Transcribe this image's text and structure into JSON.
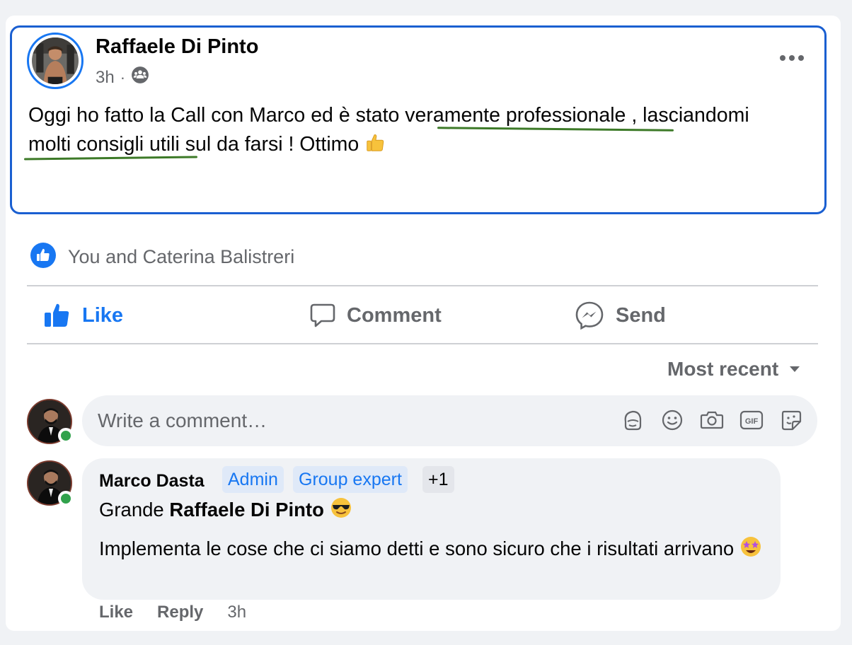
{
  "post": {
    "author": "Raffaele Di Pinto",
    "time": "3h",
    "separator": "·",
    "text_parts": [
      "Oggi ho fatto la Call con Marco ed è stato ",
      "veramente professionale",
      " , lasciandomi ",
      "molti consigli utili",
      " sul da farsi ! Ottimo "
    ],
    "emoji": "thumbs-up"
  },
  "reactions": {
    "text": "You and Caterina Balistreri"
  },
  "actions": {
    "like": "Like",
    "comment": "Comment",
    "send": "Send"
  },
  "sort": {
    "label": "Most recent"
  },
  "comment_input": {
    "placeholder": "Write a comment…",
    "icons": [
      "avatar-sticker-icon",
      "emoji-icon",
      "camera-icon",
      "gif-icon",
      "sticker-icon"
    ]
  },
  "comment": {
    "author": "Marco Dasta",
    "badges": [
      "Admin",
      "Group expert",
      "+1"
    ],
    "line1_prefix": "Grande ",
    "line1_mention": "Raffaele Di Pinto",
    "line2": "Implementa le cose che ci siamo detti e sono sicuro che i risultati arrivano",
    "like": "Like",
    "reply": "Reply",
    "time": "3h"
  },
  "colors": {
    "accent": "#1877f2",
    "highlight_border": "#1a5fd1",
    "underline": "#3d7a28",
    "online": "#31a24c"
  }
}
